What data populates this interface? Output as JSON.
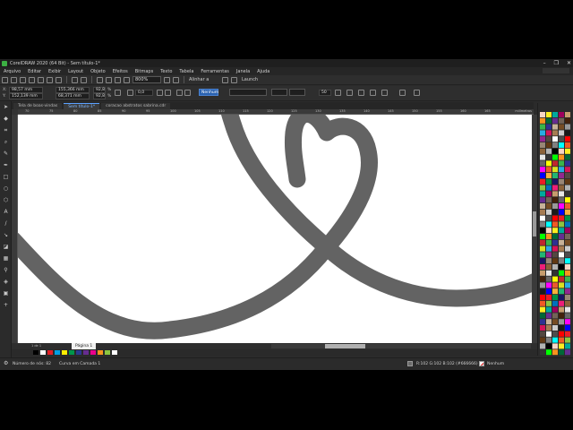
{
  "window": {
    "title": "CorelDRAW 2020 (64 Bit) - Sem título-1*",
    "controls": [
      "–",
      "❐",
      "✕"
    ]
  },
  "menu": [
    "Arquivo",
    "Editar",
    "Exibir",
    "Layout",
    "Objeto",
    "Efeitos",
    "Bitmaps",
    "Texto",
    "Tabela",
    "Ferramentas",
    "Janela",
    "Ajuda"
  ],
  "toolbar": {
    "zoom": "800%",
    "snap": "Alinhar a",
    "launch": "Launch"
  },
  "property_bar": {
    "x_label": "X:",
    "x": "98,57 mm",
    "y_label": "Y:",
    "y": "152,139 mm",
    "w": "155,366 mm",
    "h": "68,371 mm",
    "scale_w": "92,8",
    "scale_h": "92,8",
    "pct": "%",
    "angle": "0,0",
    "outline_none": "Nenhum",
    "miter": "50"
  },
  "doc_tabs": [
    {
      "label": "Tela de boas-vindas",
      "active": false
    },
    {
      "label": "Sem título-1*",
      "active": true
    },
    {
      "label": "coracao abstratos sabrina.cdr",
      "active": false
    }
  ],
  "ruler": {
    "unit": "milímetros",
    "labels": [
      "70",
      "75",
      "80",
      "85",
      "90",
      "95",
      "100",
      "105",
      "110",
      "115",
      "120",
      "125",
      "130",
      "135",
      "140",
      "145",
      "150",
      "155",
      "160",
      "165"
    ]
  },
  "canvas": {
    "stroke_color": "#636363",
    "background": "#ffffff"
  },
  "pages": {
    "counter": "1 de 1",
    "page_label": "Página 1"
  },
  "status": {
    "nodes": "Número de nós: 82",
    "object": "Curva em Camada 1",
    "fill_info": "R:102 G:102 B:102 (#666666)",
    "outline_info": "Nenhum"
  },
  "palette_colors": [
    "#000000",
    "#ffffff",
    "#e31e24",
    "#00a0e3",
    "#ffed00",
    "#00964b",
    "#2b3990",
    "#662d91",
    "#ec008c",
    "#f7941d",
    "#8dc63f",
    "#ffffff"
  ],
  "panel_colors": [
    "#f7d5c4",
    "#ec5a2a",
    "#f15a24",
    "#c1272d",
    "#ed1c24",
    "#f7931e",
    "#fbb03b",
    "#fcee21",
    "#d9e021",
    "#8cc63f",
    "#39b54a",
    "#009245",
    "#006837",
    "#22b573",
    "#00a99d",
    "#29abe2",
    "#0071bc",
    "#2e3192",
    "#1b1464",
    "#662d91",
    "#93278f",
    "#9e005d",
    "#d4145a",
    "#ed1e79",
    "#c7b299",
    "#998675",
    "#736357",
    "#534741",
    "#c69c6d",
    "#a67c52",
    "#8c6239",
    "#754c24",
    "#603813",
    "#42210b",
    "#ffffff",
    "#e6e6e6",
    "#cccccc",
    "#b3b3b3",
    "#999999",
    "#808080",
    "#666666",
    "#4d4d4d",
    "#333333",
    "#1a1a1a",
    "#000000",
    "#ff00ff",
    "#00ffff",
    "#ffff00",
    "#ff0000",
    "#00ff00",
    "#0000ff"
  ]
}
